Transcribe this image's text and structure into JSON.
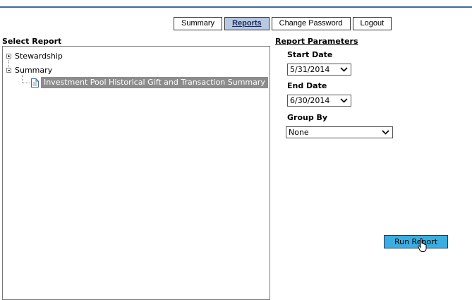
{
  "nav": {
    "items": [
      {
        "label": "Summary",
        "active": false
      },
      {
        "label": "Reports",
        "active": true
      },
      {
        "label": "Change Password",
        "active": false
      },
      {
        "label": "Logout",
        "active": false
      }
    ]
  },
  "select_report": {
    "title": "Select Report",
    "tree": {
      "stewardship": {
        "label": "Stewardship",
        "expanded": false,
        "icon": "plus-box-icon"
      },
      "summary": {
        "label": "Summary",
        "expanded": true,
        "icon": "minus-box-icon"
      },
      "selected_report": {
        "label": "Investment Pool Historical Gift and Transaction Summary",
        "icon": "document-icon"
      }
    }
  },
  "parameters": {
    "title": "Report Parameters",
    "start_date": {
      "label": "Start Date",
      "value": "5/31/2014"
    },
    "end_date": {
      "label": "End Date",
      "value": "6/30/2014"
    },
    "group_by": {
      "label": "Group By",
      "value": "None"
    },
    "run_label": "Run Report"
  },
  "colors": {
    "accent_rule": "#3c6ea6",
    "active_tab": "#b7c8e3",
    "selected_node": "#8c8c8c",
    "run_button": "#3aaee0"
  }
}
